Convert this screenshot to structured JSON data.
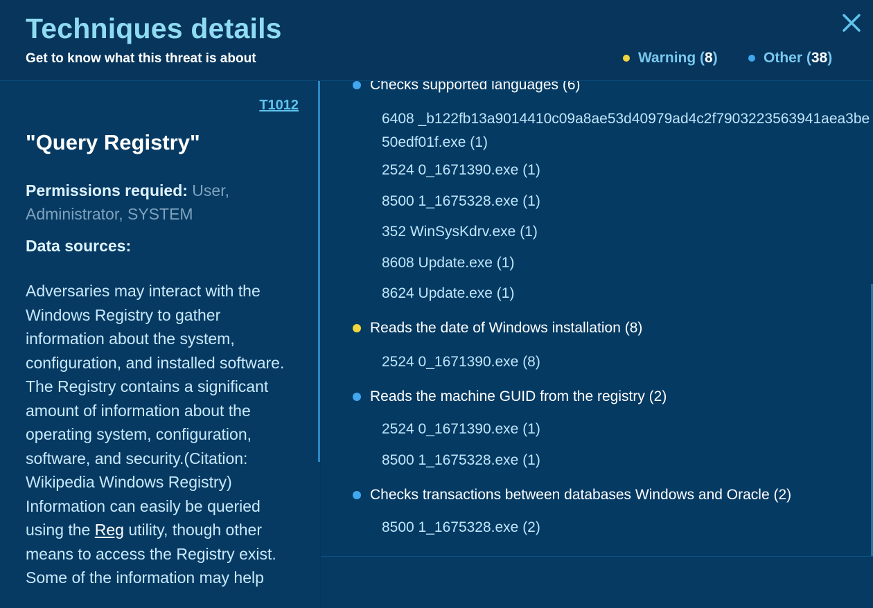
{
  "header": {
    "title": "Techniques details",
    "subtitle": "Get to know what this threat is about",
    "legend": [
      {
        "label": "Warning",
        "count": "8",
        "color": "#f2d63d"
      },
      {
        "label": "Other",
        "count": "38",
        "color": "#41a8f0"
      }
    ],
    "close_icon": "close-icon"
  },
  "technique": {
    "id": "T1012",
    "name": "\"Query Registry\"",
    "permissions_label": "Permissions requied:",
    "permissions_value": " User, Administrator, SYSTEM",
    "data_sources_label": "Data sources:",
    "description_before": "Adversaries may interact with the Windows Registry to gather information about the system, configuration, and installed software.\nThe Registry contains a significant amount of information about the operating system, configuration, software, and security.(Citation: Wikipedia Windows Registry) Information can easily be queried using the ",
    "description_link": "Reg",
    "description_after": " utility, though other means to access the Registry exist. Some of the information may help"
  },
  "groups": [
    {
      "label": "Checks supported languages (6)",
      "severity": "other",
      "processes": [
        "6408 _b122fb13a9014410c09a8ae53d40979ad4c2f7903223563941aea3be50edf01f.exe (1)",
        "2524 0_1671390.exe (1)",
        "8500 1_1675328.exe (1)",
        "352 WinSysKdrv.exe (1)",
        "8608 Update.exe (1)",
        "8624 Update.exe (1)"
      ]
    },
    {
      "label": "Reads the date of Windows installation (8)",
      "severity": "warning",
      "processes": [
        "2524 0_1671390.exe (8)"
      ]
    },
    {
      "label": "Reads the machine GUID from the registry (2)",
      "severity": "other",
      "processes": [
        "2524 0_1671390.exe (1)",
        "8500 1_1675328.exe (1)"
      ]
    },
    {
      "label": "Checks transactions between databases Windows and Oracle (2)",
      "severity": "other",
      "processes": [
        "8500 1_1675328.exe (2)"
      ]
    }
  ],
  "colors": {
    "warning": "#f2d63d",
    "other": "#41a8f0",
    "title": "#8fdcf2"
  }
}
